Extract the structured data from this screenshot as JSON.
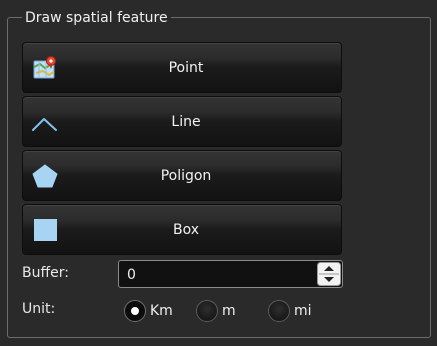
{
  "group": {
    "title": "Draw spatial feature"
  },
  "buttons": [
    {
      "label": "Point",
      "icon": "map-pin-icon"
    },
    {
      "label": "Line",
      "icon": "polyline-icon"
    },
    {
      "label": "Poligon",
      "icon": "pentagon-icon"
    },
    {
      "label": "Box",
      "icon": "square-icon"
    }
  ],
  "buffer": {
    "label": "Buffer:",
    "value": "0"
  },
  "unit": {
    "label": "Unit:",
    "options": [
      {
        "label": "Km",
        "selected": true
      },
      {
        "label": "m",
        "selected": false
      },
      {
        "label": "mi",
        "selected": false
      }
    ]
  },
  "colors": {
    "background": "#2a2a2a",
    "icon_fill": "#a8d4f4",
    "line_icon": "#7fc4f0",
    "pin": "#e8452f"
  }
}
